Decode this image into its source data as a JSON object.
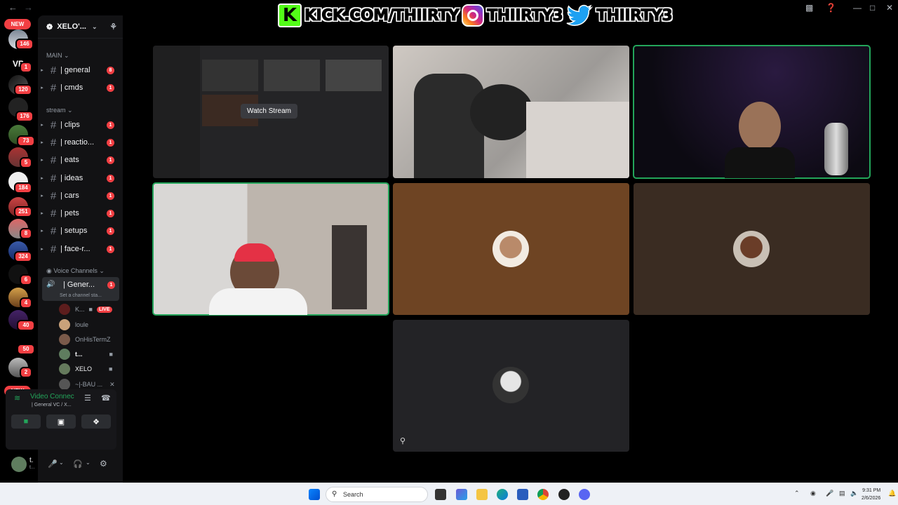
{
  "banner": {
    "kick_letter": "K",
    "kick_text": "KICK.COM/THIIRTY",
    "instagram_text": "THIIRTY3",
    "twitter_text": "THIIRTY3"
  },
  "rail": {
    "new_top": "NEW",
    "new_bottom": "NEW",
    "badges": [
      "146",
      "1",
      "120",
      "176",
      "73",
      "5",
      "184",
      "251",
      "8",
      "324",
      "6",
      "4",
      "40",
      "50",
      "2"
    ]
  },
  "server": {
    "name": "XELO'...",
    "categories": {
      "main": "MAIN",
      "stream": "stream",
      "voice": "Voice Channels"
    },
    "channels": [
      {
        "name": "| general",
        "count": "8"
      },
      {
        "name": "| cmds",
        "count": "1"
      },
      {
        "name": "| clips",
        "count": "1"
      },
      {
        "name": "| reactio...",
        "count": "1"
      },
      {
        "name": "| eats",
        "count": "1"
      },
      {
        "name": "| ideas",
        "count": "1"
      },
      {
        "name": "| cars",
        "count": "1"
      },
      {
        "name": "| pets",
        "count": "1"
      },
      {
        "name": "| setups",
        "count": "1"
      },
      {
        "name": "| face-r...",
        "count": "1"
      }
    ],
    "voice_channel": {
      "name": "| Gener...",
      "count": "1",
      "status_placeholder": "Set a channel sta..."
    },
    "members": [
      {
        "name": "K...",
        "live": "LIVE"
      },
      {
        "name": "loule"
      },
      {
        "name": "OnHisTermZ"
      },
      {
        "name": "t..."
      },
      {
        "name": "XELO"
      },
      {
        "name": "~|-BAU ..."
      }
    ]
  },
  "vc_panel": {
    "status": "Video Connec",
    "sub": "| General VC / X..."
  },
  "user_panel": {
    "name": "t.",
    "sub": "t..."
  },
  "stage": {
    "watch_stream": "Watch Stream"
  },
  "taskbar": {
    "search_placeholder": "Search",
    "time": "9:31 PM",
    "date": "2/6/2026"
  },
  "colors": {
    "speaking": "#23a55a",
    "unread": "#f23f43",
    "tile_brown": "#6e4423",
    "tile_dark_brown": "#3a2c22",
    "tile_gray": "#232326"
  }
}
